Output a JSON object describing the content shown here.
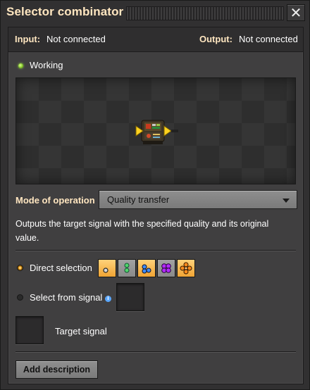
{
  "window": {
    "title": "Selector combinator",
    "close_icon": "close-icon"
  },
  "connections": {
    "input_label": "Input:",
    "input_value": "Not connected",
    "output_label": "Output:",
    "output_value": "Not connected"
  },
  "status": {
    "text": "Working",
    "color": "#7ec224"
  },
  "mode": {
    "label": "Mode of operation",
    "selected": "Quality transfer"
  },
  "description": "Outputs the target signal with the specified quality and its original value.",
  "direct_selection": {
    "label": "Direct selection",
    "selected": true,
    "qualities": [
      {
        "icon": "quality-normal-icon",
        "selected": true
      },
      {
        "icon": "quality-uncommon-icon",
        "selected": false
      },
      {
        "icon": "quality-rare-icon",
        "selected": true
      },
      {
        "icon": "quality-epic-icon",
        "selected": false
      },
      {
        "icon": "quality-legendary-icon",
        "selected": true
      }
    ]
  },
  "select_from_signal": {
    "label": "Select from signal",
    "selected": false,
    "info_icon": "info-icon"
  },
  "target_signal": {
    "label": "Target signal"
  },
  "add_description": "Add description",
  "colors": {
    "accent_orange": "#f0a434",
    "header_text": "#ffe6c0"
  }
}
